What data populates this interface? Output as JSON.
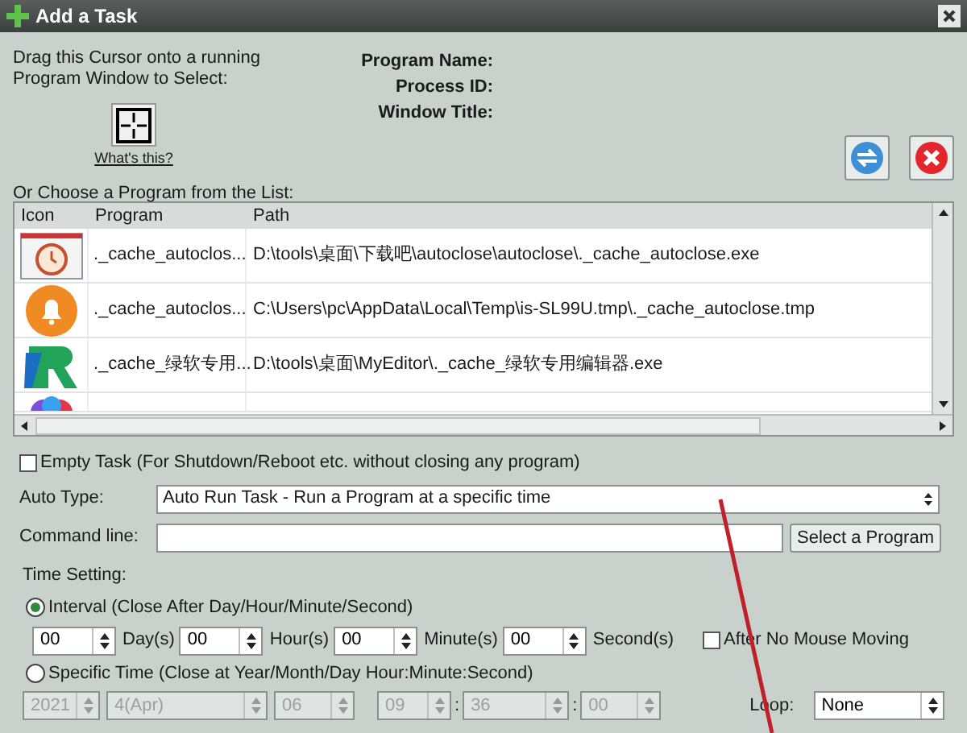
{
  "window": {
    "title": "Add a Task"
  },
  "drag_hint": "Drag this Cursor onto a running Program Window to Select:",
  "whats_this": "What's this?",
  "info_labels": [
    "Program Name:",
    "Process ID:",
    "Window Title:"
  ],
  "list_label": "Or Choose a Program from the List:",
  "table": {
    "columns": [
      "Icon",
      "Program",
      "Path"
    ],
    "rows": [
      {
        "kind": "clock",
        "program": "._cache_autoclos...",
        "path": "D:\\tools\\桌面\\下载吧\\autoclose\\autoclose\\._cache_autoclose.exe"
      },
      {
        "kind": "bell",
        "program": "._cache_autoclos...",
        "path": "C:\\Users\\pc\\AppData\\Local\\Temp\\is-SL99U.tmp\\._cache_autoclose.tmp"
      },
      {
        "kind": "logo",
        "program": "._cache_绿软专用...",
        "path": "D:\\tools\\桌面\\MyEditor\\._cache_绿软专用编辑器.exe"
      },
      {
        "kind": "petals"
      }
    ]
  },
  "empty_task": {
    "label": "Empty Task (For Shutdown/Reboot etc. without closing any program)",
    "checked": false
  },
  "auto_type": {
    "label": "Auto Type:",
    "value": "Auto Run Task - Run a Program at a specific time"
  },
  "command_line": {
    "label": "Command line:",
    "button": "Select a Program"
  },
  "time_setting": "Time Setting:",
  "interval": {
    "label": "Interval (Close After Day/Hour/Minute/Second)",
    "selected": true,
    "fields": [
      {
        "value": "00",
        "unit": "Day(s)"
      },
      {
        "value": "00",
        "unit": "Hour(s)"
      },
      {
        "value": "00",
        "unit": "Minute(s)"
      },
      {
        "value": "00",
        "unit": "Second(s)"
      }
    ],
    "after_no_mouse": {
      "label": "After No Mouse Moving",
      "checked": false
    }
  },
  "specific": {
    "label": "Specific Time (Close at Year/Month/Day Hour:Minute:Second)",
    "selected": false,
    "disabled": true,
    "fields": [
      {
        "value": "2021"
      },
      {
        "value": "4(Apr)"
      },
      {
        "value": "06"
      },
      {
        "value": "09"
      },
      {
        "value": "36",
        "sep": ":"
      },
      {
        "value": "00",
        "sep": ":"
      }
    ]
  },
  "loop": {
    "label": "Loop:",
    "value": "None"
  }
}
